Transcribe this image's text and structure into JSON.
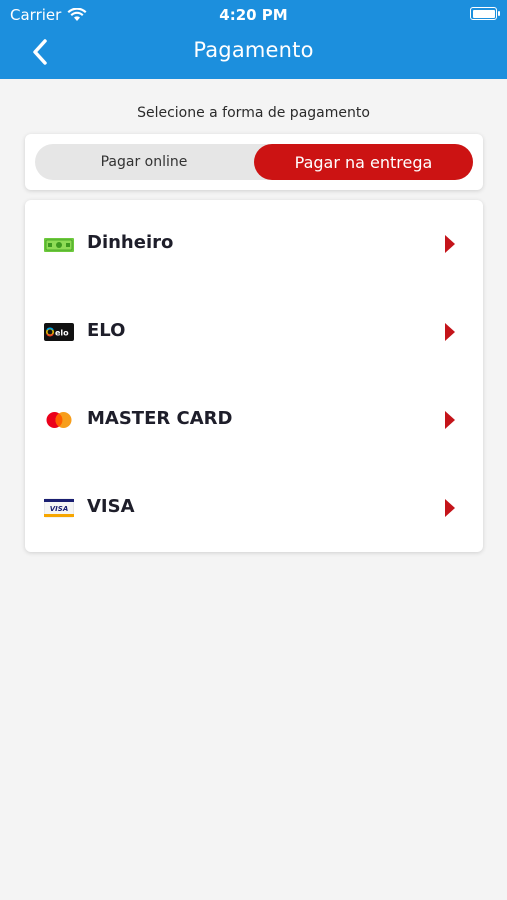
{
  "status_bar": {
    "carrier": "Carrier",
    "time": "4:20 PM"
  },
  "header": {
    "title": "Pagamento",
    "back_icon": "chevron-left-icon",
    "background": "#1c8fdd"
  },
  "subtitle": "Selecione a forma de pagamento",
  "toggle": {
    "options": [
      "Pagar online",
      "Pagar na entrega"
    ],
    "selected": "Pagar na entrega",
    "accent": "#cc1313"
  },
  "payment_methods": [
    {
      "label": "Dinheiro",
      "icon": "cash-icon"
    },
    {
      "label": "ELO",
      "icon": "elo-card-icon"
    },
    {
      "label": "MASTER CARD",
      "icon": "mastercard-icon"
    },
    {
      "label": "VISA",
      "icon": "visa-card-icon"
    }
  ]
}
